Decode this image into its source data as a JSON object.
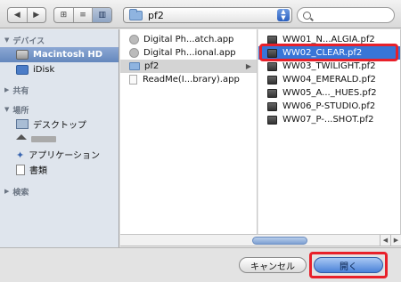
{
  "toolbar": {
    "back_label": "◀",
    "forward_label": "▶",
    "view_icons_label": "⊞",
    "view_list_label": "≡",
    "view_columns_label": "▥",
    "location": "pf2",
    "search_placeholder": ""
  },
  "sidebar": {
    "devices_header": "デバイス",
    "devices": [
      {
        "label": "Macintosh HD",
        "icon": "hard-drive-icon",
        "selected": true
      },
      {
        "label": "iDisk",
        "icon": "idisk-icon"
      }
    ],
    "shared_header": "共有",
    "places_header": "場所",
    "places": [
      {
        "label": "デスクトップ",
        "icon": "desktop-icon"
      },
      {
        "label": "",
        "icon": "home-icon"
      },
      {
        "label": "アプリケーション",
        "icon": "applications-icon"
      },
      {
        "label": "書類",
        "icon": "documents-icon"
      }
    ],
    "search_header": "検索"
  },
  "column1": {
    "items": [
      {
        "label": "Digital Ph...atch.app",
        "icon": "app-icon"
      },
      {
        "label": "Digital Ph...ional.app",
        "icon": "app-icon"
      },
      {
        "label": "pf2",
        "icon": "folder-icon",
        "selected": true,
        "has_children": true
      },
      {
        "label": "ReadMe(I...brary).app",
        "icon": "document-icon"
      }
    ]
  },
  "column2": {
    "items": [
      {
        "label": "WW01_N...ALGIA.pf2"
      },
      {
        "label": "WW02_CLEAR.pf2",
        "selected": true
      },
      {
        "label": "WW03_TWILIGHT.pf2"
      },
      {
        "label": "WW04_EMERALD.pf2"
      },
      {
        "label": "WW05_A..._HUES.pf2"
      },
      {
        "label": "WW06_P-STUDIO.pf2"
      },
      {
        "label": "WW07_P-...SHOT.pf2"
      }
    ]
  },
  "footer": {
    "cancel_label": "キャンセル",
    "open_label": "開く"
  },
  "colors": {
    "selection_blue": "#3875d7",
    "highlight_red": "#e8202a"
  }
}
